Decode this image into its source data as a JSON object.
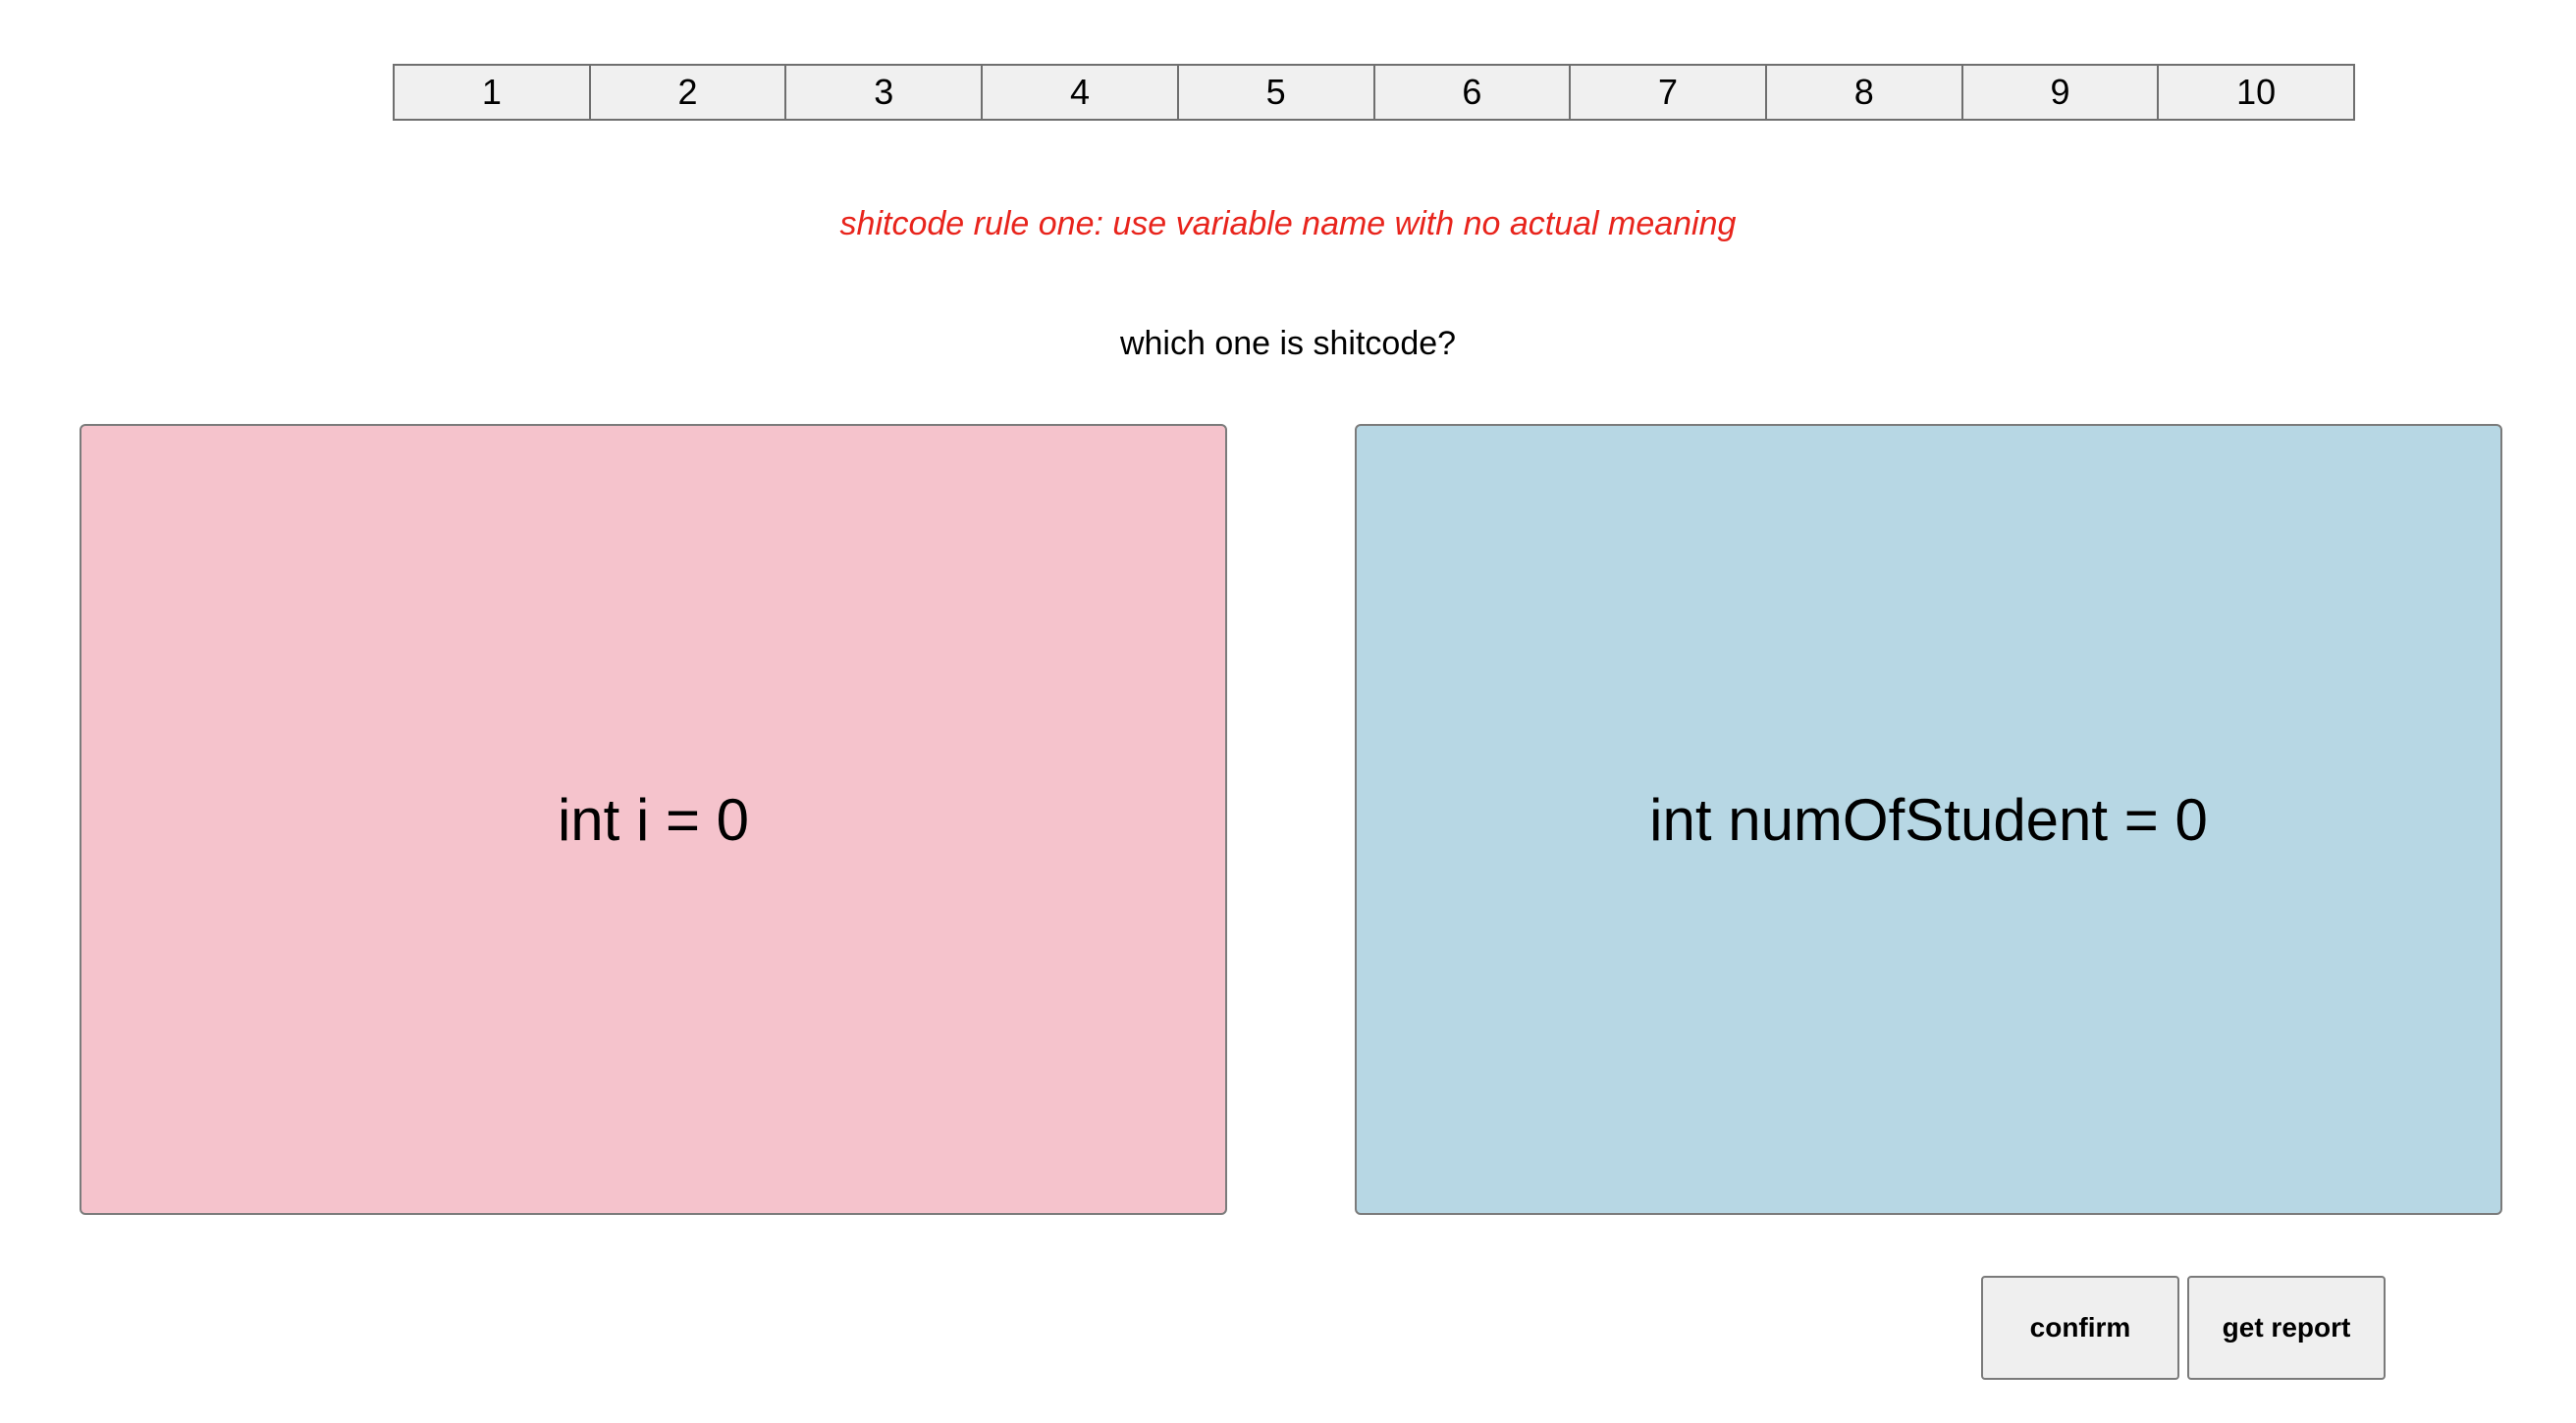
{
  "pagination": {
    "pages": [
      "1",
      "2",
      "3",
      "4",
      "5",
      "6",
      "7",
      "8",
      "9",
      "10"
    ]
  },
  "rule": {
    "text": "shitcode rule one: use variable name with no actual meaning",
    "color": "#e8241c"
  },
  "question": {
    "text": "which one is shitcode?"
  },
  "options": {
    "a": {
      "code": "int i = 0",
      "color": "#f5c3cc"
    },
    "b": {
      "code": "int numOfStudent = 0",
      "color": "#b7d7e4"
    }
  },
  "actions": {
    "confirm_label": "confirm",
    "report_label": "get report"
  }
}
